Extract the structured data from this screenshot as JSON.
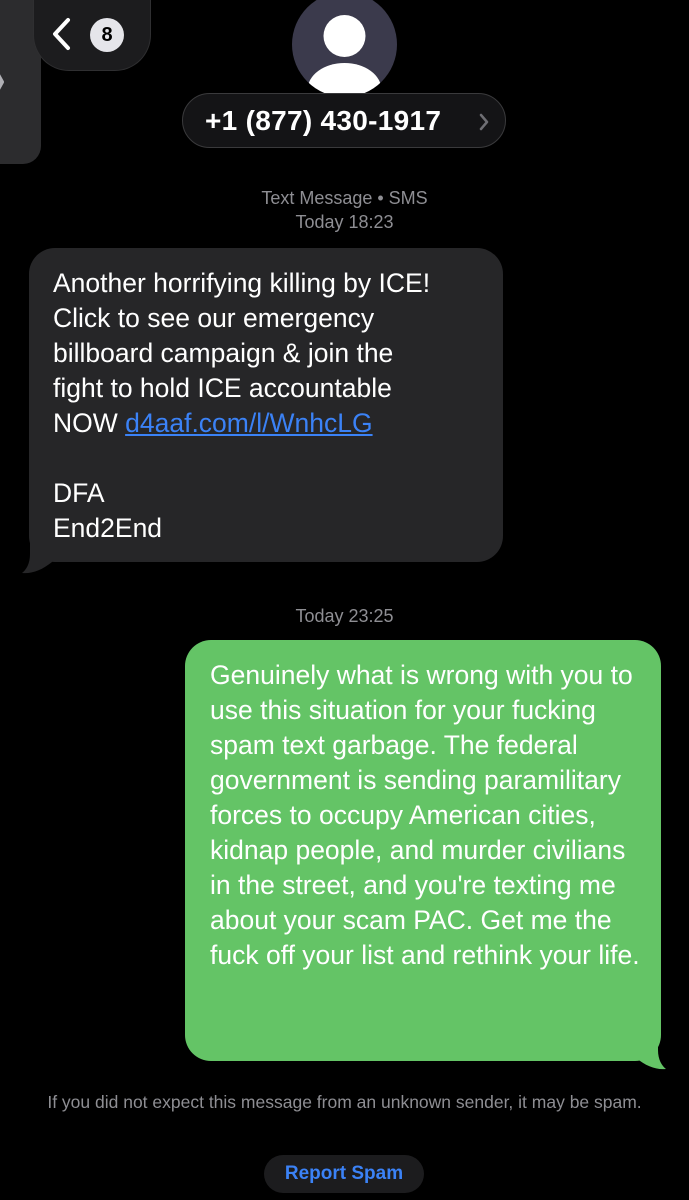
{
  "header": {
    "back_badge_count": "8",
    "contact_number": "+1 (877) 430-1917"
  },
  "thread": {
    "first_meta_line1": "Text Message • SMS",
    "first_meta_line2": "Today 18:23",
    "incoming": {
      "text_before_link": "Another horrifying killing by ICE!\nClick to see our emergency\nbillboard campaign & join the\nfight to hold ICE accountable\nNOW ",
      "link": "d4aaf.com/l/WnhcLG",
      "text_after_link": "\n\nDFA\nEnd2End"
    },
    "second_meta": "Today 23:25",
    "outgoing": {
      "text": "Genuinely what is wrong with you to use this situation for your fucking spam text garbage. The federal government is sending paramilitary forces to occupy American cities, kidnap people, and murder civilians in the street, and you're texting me about your scam PAC. Get me the fuck off your list and rethink your life."
    }
  },
  "footer": {
    "spam_notice": "If you did not expect this message from an unknown sender, it may be spam.",
    "report_spam_label": "Report Spam"
  },
  "colors": {
    "incoming_bubble": "#262628",
    "outgoing_bubble": "#64c466",
    "link": "#3b82f6",
    "meta_text": "#8e8e93"
  },
  "icons": {
    "edge": "chevron-right-icon",
    "back": "chevron-left-icon",
    "avatar": "person-silhouette-icon",
    "contact": "chevron-right-icon"
  }
}
